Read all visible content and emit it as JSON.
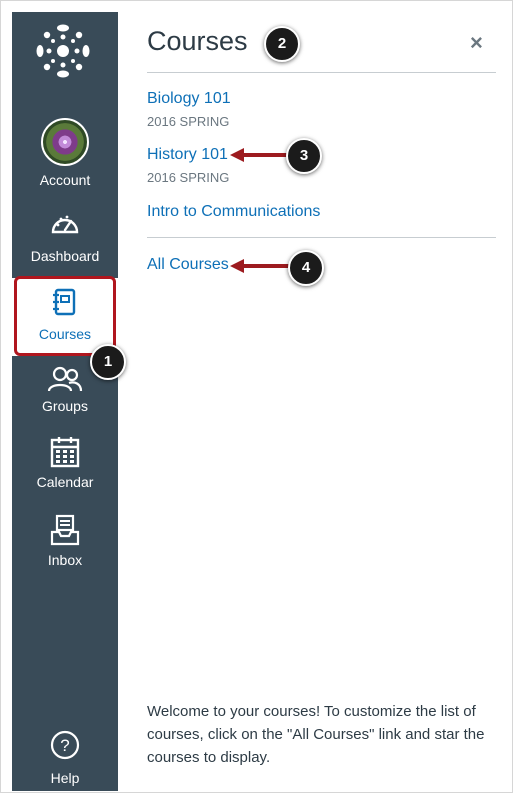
{
  "nav": {
    "items": [
      {
        "label": "Account"
      },
      {
        "label": "Dashboard"
      },
      {
        "label": "Courses"
      },
      {
        "label": "Groups"
      },
      {
        "label": "Calendar"
      },
      {
        "label": "Inbox"
      },
      {
        "label": "Help"
      }
    ]
  },
  "tray": {
    "title": "Courses",
    "close_label": "×",
    "courses": [
      {
        "name": "Biology 101",
        "term": "2016 SPRING"
      },
      {
        "name": "History 101",
        "term": "2016 SPRING"
      },
      {
        "name": "Intro to Communications",
        "term": ""
      }
    ],
    "all_courses": "All Courses",
    "welcome": "Welcome to your courses! To customize the list of courses, click on the \"All Courses\" link and star the courses to display."
  },
  "callouts": [
    "1",
    "2",
    "3",
    "4"
  ],
  "colors": {
    "nav_bg": "#394b58",
    "link": "#0e70b7",
    "callout_arrow": "#9d1b1f",
    "highlight_border": "#b0161e"
  },
  "icons": [
    "canvas-logo-icon",
    "dashboard-icon",
    "courses-icon",
    "groups-icon",
    "calendar-icon",
    "inbox-icon",
    "help-icon"
  ]
}
